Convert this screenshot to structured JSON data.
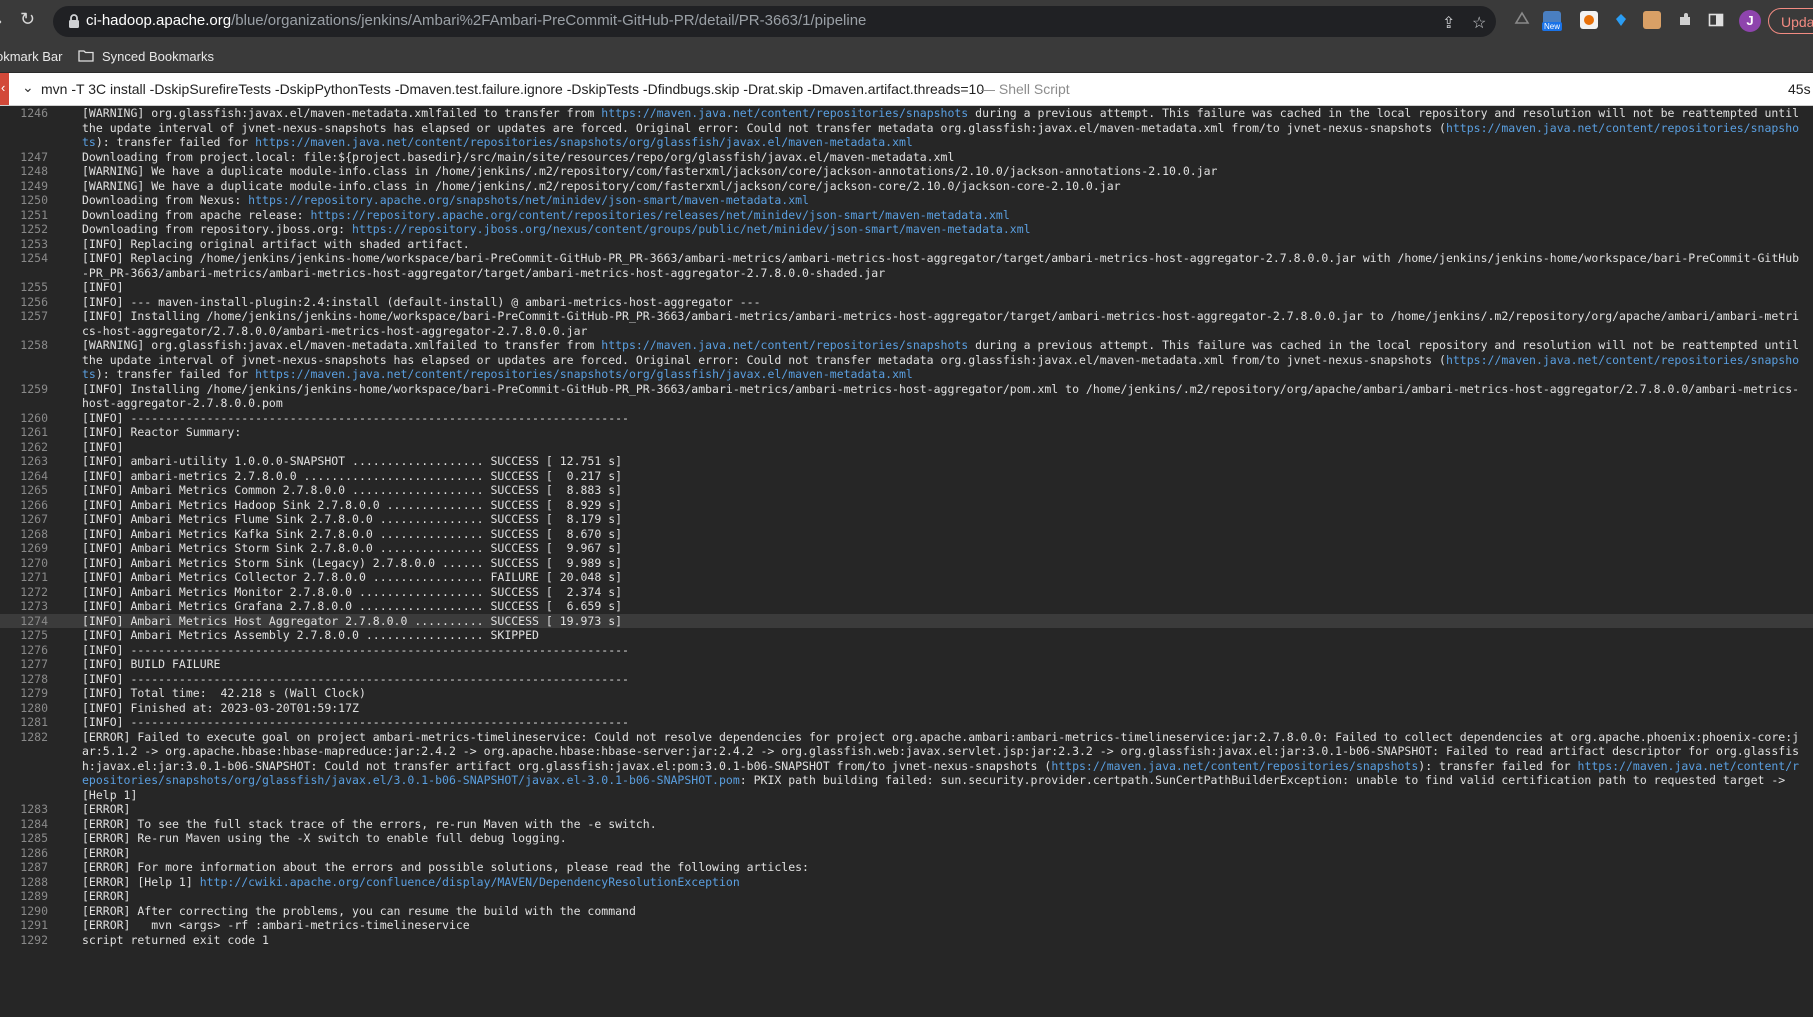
{
  "browser": {
    "url_host": "ci-hadoop.apache.org",
    "url_path": "/blue/organizations/jenkins/Ambari%2FAmbari-PreCommit-GitHub-PR/detail/PR-3663/1/pipeline",
    "profile_initial": "J",
    "update_label": "Upda",
    "new_badge": "New"
  },
  "bookmarks": {
    "bar_label": "okmark Bar",
    "synced_label": "Synced Bookmarks"
  },
  "step": {
    "command": "mvn -T 3C install -DskipSurefireTests -DskipPythonTests -Dmaven.test.failure.ignore -DskipTests -Dfindbugs.skip -Drat.skip -Dmaven.artifact.threads=10",
    "kind": "— Shell Script",
    "duration": "45s"
  },
  "log": [
    {
      "n": "1246",
      "segs": [
        {
          "t": "[WARNING] org.glassfish:javax.el/maven-metadata.xmlfailed to transfer from "
        },
        {
          "t": "https://maven.java.net/content/repositories/snapshots",
          "link": true
        },
        {
          "t": " during a previous attempt. This failure was cached in the local repository and resolution will not be reattempted until the update interval of jvnet-nexus-snapshots has elapsed or updates are forced. Original error: Could not transfer metadata org.glassfish:javax.el/maven-metadata.xml from/to jvnet-nexus-snapshots ("
        },
        {
          "t": "https://maven.java.net/content/repositories/snapshots",
          "link": true
        },
        {
          "t": "): transfer failed for "
        },
        {
          "t": "https://maven.java.net/content/repositories/snapshots/org/glassfish/javax.el/maven-metadata.xml",
          "link": true
        }
      ]
    },
    {
      "n": "1247",
      "segs": [
        {
          "t": "Downloading from project.local: file:${project.basedir}/src/main/site/resources/repo/org/glassfish/javax.el/maven-metadata.xml"
        }
      ]
    },
    {
      "n": "1248",
      "segs": [
        {
          "t": "[WARNING] We have a duplicate module-info.class in /home/jenkins/.m2/repository/com/fasterxml/jackson/core/jackson-annotations/2.10.0/jackson-annotations-2.10.0.jar"
        }
      ]
    },
    {
      "n": "1249",
      "segs": [
        {
          "t": "[WARNING] We have a duplicate module-info.class in /home/jenkins/.m2/repository/com/fasterxml/jackson/core/jackson-core/2.10.0/jackson-core-2.10.0.jar"
        }
      ]
    },
    {
      "n": "1250",
      "segs": [
        {
          "t": "Downloading from Nexus: "
        },
        {
          "t": "https://repository.apache.org/snapshots/net/minidev/json-smart/maven-metadata.xml",
          "link": true
        }
      ]
    },
    {
      "n": "1251",
      "segs": [
        {
          "t": "Downloading from apache release: "
        },
        {
          "t": "https://repository.apache.org/content/repositories/releases/net/minidev/json-smart/maven-metadata.xml",
          "link": true
        }
      ]
    },
    {
      "n": "1252",
      "segs": [
        {
          "t": "Downloading from repository.jboss.org: "
        },
        {
          "t": "https://repository.jboss.org/nexus/content/groups/public/net/minidev/json-smart/maven-metadata.xml",
          "link": true
        }
      ]
    },
    {
      "n": "1253",
      "segs": [
        {
          "t": "[INFO] Replacing original artifact with shaded artifact."
        }
      ]
    },
    {
      "n": "1254",
      "segs": [
        {
          "t": "[INFO] Replacing /home/jenkins/jenkins-home/workspace/bari-PreCommit-GitHub-PR_PR-3663/ambari-metrics/ambari-metrics-host-aggregator/target/ambari-metrics-host-aggregator-2.7.8.0.0.jar with /home/jenkins/jenkins-home/workspace/bari-PreCommit-GitHub-PR_PR-3663/ambari-metrics/ambari-metrics-host-aggregator/target/ambari-metrics-host-aggregator-2.7.8.0.0-shaded.jar"
        }
      ]
    },
    {
      "n": "1255",
      "segs": [
        {
          "t": "[INFO]"
        }
      ]
    },
    {
      "n": "1256",
      "segs": [
        {
          "t": "[INFO] --- maven-install-plugin:2.4:install (default-install) @ ambari-metrics-host-aggregator ---"
        }
      ]
    },
    {
      "n": "1257",
      "segs": [
        {
          "t": "[INFO] Installing /home/jenkins/jenkins-home/workspace/bari-PreCommit-GitHub-PR_PR-3663/ambari-metrics/ambari-metrics-host-aggregator/target/ambari-metrics-host-aggregator-2.7.8.0.0.jar to /home/jenkins/.m2/repository/org/apache/ambari/ambari-metrics-host-aggregator/2.7.8.0.0/ambari-metrics-host-aggregator-2.7.8.0.0.jar"
        }
      ]
    },
    {
      "n": "1258",
      "segs": [
        {
          "t": "[WARNING] org.glassfish:javax.el/maven-metadata.xmlfailed to transfer from "
        },
        {
          "t": "https://maven.java.net/content/repositories/snapshots",
          "link": true
        },
        {
          "t": " during a previous attempt. This failure was cached in the local repository and resolution will not be reattempted until the update interval of jvnet-nexus-snapshots has elapsed or updates are forced. Original error: Could not transfer metadata org.glassfish:javax.el/maven-metadata.xml from/to jvnet-nexus-snapshots ("
        },
        {
          "t": "https://maven.java.net/content/repositories/snapshots",
          "link": true
        },
        {
          "t": "): transfer failed for "
        },
        {
          "t": "https://maven.java.net/content/repositories/snapshots/org/glassfish/javax.el/maven-metadata.xml",
          "link": true
        }
      ]
    },
    {
      "n": "1259",
      "segs": [
        {
          "t": "[INFO] Installing /home/jenkins/jenkins-home/workspace/bari-PreCommit-GitHub-PR_PR-3663/ambari-metrics/ambari-metrics-host-aggregator/pom.xml to /home/jenkins/.m2/repository/org/apache/ambari/ambari-metrics-host-aggregator/2.7.8.0.0/ambari-metrics-host-aggregator-2.7.8.0.0.pom"
        }
      ]
    },
    {
      "n": "1260",
      "segs": [
        {
          "t": "[INFO] ------------------------------------------------------------------------"
        }
      ]
    },
    {
      "n": "1261",
      "segs": [
        {
          "t": "[INFO] Reactor Summary:"
        }
      ]
    },
    {
      "n": "1262",
      "segs": [
        {
          "t": "[INFO]"
        }
      ]
    },
    {
      "n": "1263",
      "segs": [
        {
          "t": "[INFO] ambari-utility 1.0.0.0-SNAPSHOT ................... SUCCESS [ 12.751 s]"
        }
      ]
    },
    {
      "n": "1264",
      "segs": [
        {
          "t": "[INFO] ambari-metrics 2.7.8.0.0 .......................... SUCCESS [  0.217 s]"
        }
      ]
    },
    {
      "n": "1265",
      "segs": [
        {
          "t": "[INFO] Ambari Metrics Common 2.7.8.0.0 ................... SUCCESS [  8.883 s]"
        }
      ]
    },
    {
      "n": "1266",
      "segs": [
        {
          "t": "[INFO] Ambari Metrics Hadoop Sink 2.7.8.0.0 .............. SUCCESS [  8.929 s]"
        }
      ]
    },
    {
      "n": "1267",
      "segs": [
        {
          "t": "[INFO] Ambari Metrics Flume Sink 2.7.8.0.0 ............... SUCCESS [  8.179 s]"
        }
      ]
    },
    {
      "n": "1268",
      "segs": [
        {
          "t": "[INFO] Ambari Metrics Kafka Sink 2.7.8.0.0 ............... SUCCESS [  8.670 s]"
        }
      ]
    },
    {
      "n": "1269",
      "segs": [
        {
          "t": "[INFO] Ambari Metrics Storm Sink 2.7.8.0.0 ............... SUCCESS [  9.967 s]"
        }
      ]
    },
    {
      "n": "1270",
      "segs": [
        {
          "t": "[INFO] Ambari Metrics Storm Sink (Legacy) 2.7.8.0.0 ...... SUCCESS [  9.989 s]"
        }
      ]
    },
    {
      "n": "1271",
      "segs": [
        {
          "t": "[INFO] Ambari Metrics Collector 2.7.8.0.0 ................ FAILURE [ 20.048 s]"
        }
      ]
    },
    {
      "n": "1272",
      "segs": [
        {
          "t": "[INFO] Ambari Metrics Monitor 2.7.8.0.0 .................. SUCCESS [  2.374 s]"
        }
      ]
    },
    {
      "n": "1273",
      "segs": [
        {
          "t": "[INFO] Ambari Metrics Grafana 2.7.8.0.0 .................. SUCCESS [  6.659 s]"
        }
      ]
    },
    {
      "n": "1274",
      "hl": true,
      "segs": [
        {
          "t": "[INFO] Ambari Metrics Host Aggregator 2.7.8.0.0 .......... SUCCESS [ 19.973 s]"
        }
      ]
    },
    {
      "n": "1275",
      "segs": [
        {
          "t": "[INFO] Ambari Metrics Assembly 2.7.8.0.0 ................. SKIPPED"
        }
      ]
    },
    {
      "n": "1276",
      "segs": [
        {
          "t": "[INFO] ------------------------------------------------------------------------"
        }
      ]
    },
    {
      "n": "1277",
      "segs": [
        {
          "t": "[INFO] BUILD FAILURE"
        }
      ]
    },
    {
      "n": "1278",
      "segs": [
        {
          "t": "[INFO] ------------------------------------------------------------------------"
        }
      ]
    },
    {
      "n": "1279",
      "segs": [
        {
          "t": "[INFO] Total time:  42.218 s (Wall Clock)"
        }
      ]
    },
    {
      "n": "1280",
      "segs": [
        {
          "t": "[INFO] Finished at: 2023-03-20T01:59:17Z"
        }
      ]
    },
    {
      "n": "1281",
      "segs": [
        {
          "t": "[INFO] ------------------------------------------------------------------------"
        }
      ]
    },
    {
      "n": "1282",
      "segs": [
        {
          "t": "[ERROR] Failed to execute goal on project ambari-metrics-timelineservice: Could not resolve dependencies for project org.apache.ambari:ambari-metrics-timelineservice:jar:2.7.8.0.0: Failed to collect dependencies at org.apache.phoenix:phoenix-core:jar:5.1.2 -> org.apache.hbase:hbase-mapreduce:jar:2.4.2 -> org.apache.hbase:hbase-server:jar:2.4.2 -> org.glassfish.web:javax.servlet.jsp:jar:2.3.2 -> org.glassfish:javax.el:jar:3.0.1-b06-SNAPSHOT: Failed to read artifact descriptor for org.glassfish:javax.el:jar:3.0.1-b06-SNAPSHOT: Could not transfer artifact org.glassfish:javax.el:pom:3.0.1-b06-SNAPSHOT from/to jvnet-nexus-snapshots ("
        },
        {
          "t": "https://maven.java.net/content/repositories/snapshots",
          "link": true
        },
        {
          "t": "): transfer failed for "
        },
        {
          "t": "https://maven.java.net/content/repositories/snapshots/org/glassfish/javax.el/3.0.1-b06-SNAPSHOT/javax.el-3.0.1-b06-SNAPSHOT.pom",
          "link": true
        },
        {
          "t": ": PKIX path building failed: sun.security.provider.certpath.SunCertPathBuilderException: unable to find valid certification path to requested target -> [Help 1]"
        }
      ]
    },
    {
      "n": "1283",
      "segs": [
        {
          "t": "[ERROR]"
        }
      ]
    },
    {
      "n": "1284",
      "segs": [
        {
          "t": "[ERROR] To see the full stack trace of the errors, re-run Maven with the -e switch."
        }
      ]
    },
    {
      "n": "1285",
      "segs": [
        {
          "t": "[ERROR] Re-run Maven using the -X switch to enable full debug logging."
        }
      ]
    },
    {
      "n": "1286",
      "segs": [
        {
          "t": "[ERROR]"
        }
      ]
    },
    {
      "n": "1287",
      "segs": [
        {
          "t": "[ERROR] For more information about the errors and possible solutions, please read the following articles:"
        }
      ]
    },
    {
      "n": "1288",
      "segs": [
        {
          "t": "[ERROR] [Help 1] "
        },
        {
          "t": "http://cwiki.apache.org/confluence/display/MAVEN/DependencyResolutionException",
          "link": true
        }
      ]
    },
    {
      "n": "1289",
      "segs": [
        {
          "t": "[ERROR]"
        }
      ]
    },
    {
      "n": "1290",
      "segs": [
        {
          "t": "[ERROR] After correcting the problems, you can resume the build with the command"
        }
      ]
    },
    {
      "n": "1291",
      "segs": [
        {
          "t": "[ERROR]   mvn <args> -rf :ambari-metrics-timelineservice"
        }
      ]
    },
    {
      "n": "1292",
      "segs": [
        {
          "t": "script returned exit code 1"
        }
      ]
    }
  ],
  "colors": {
    "accent_red": "#d24939",
    "link": "#5a9fe0",
    "console_bg": "#262626"
  }
}
